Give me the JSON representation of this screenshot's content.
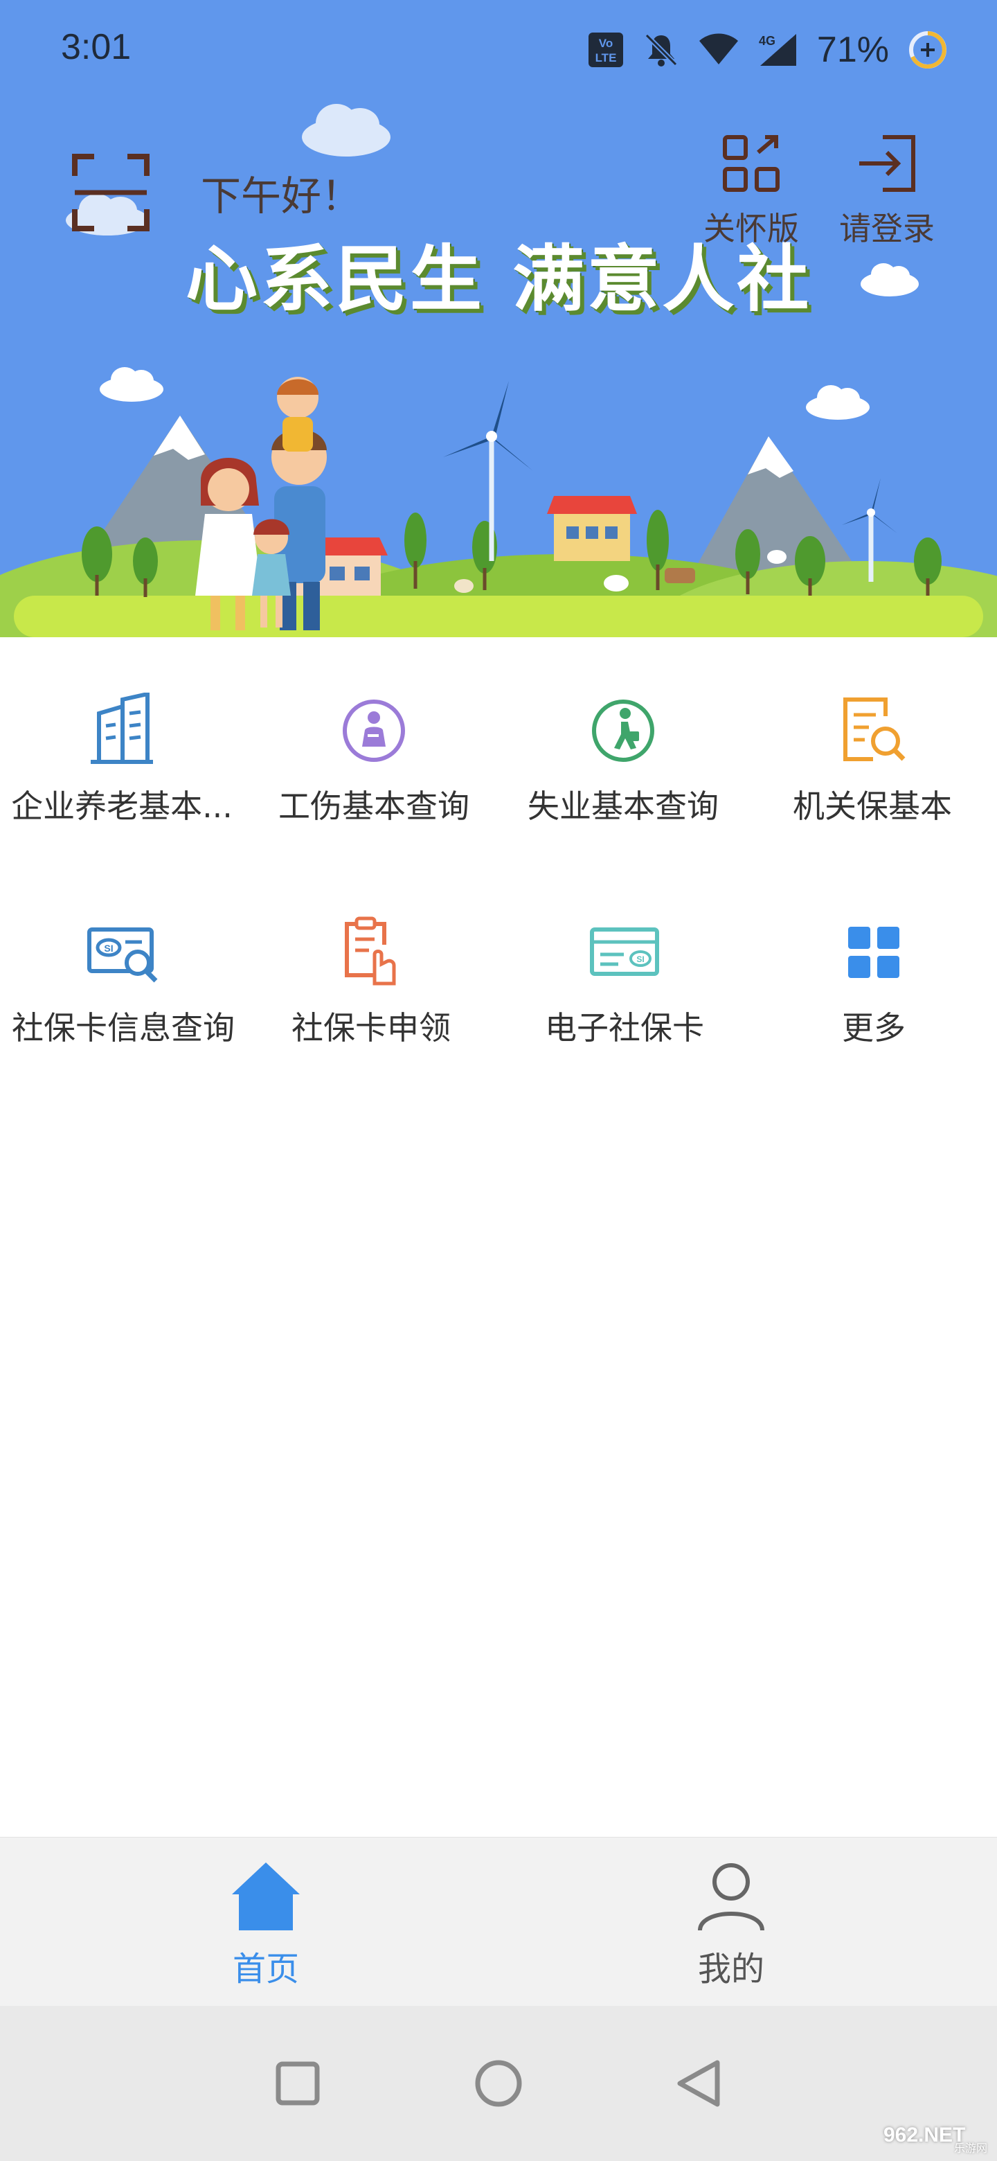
{
  "status_bar": {
    "time": "3:01",
    "battery": "71%",
    "icons": [
      "volte-icon",
      "mute-icon",
      "wifi-icon",
      "signal-4g-icon",
      "battery-saver-icon"
    ]
  },
  "header": {
    "greeting": "下午好！",
    "slogan": "心系民生 满意人社",
    "care_mode_label": "关怀版",
    "login_label": "请登录"
  },
  "services": [
    {
      "label": "企业养老基本...",
      "icon": "building-icon",
      "color": "#3D84C6"
    },
    {
      "label": "工伤基本查询",
      "icon": "injury-icon",
      "color": "#9B7BD8"
    },
    {
      "label": "失业基本查询",
      "icon": "walking-person-icon",
      "color": "#3FA56B"
    },
    {
      "label": "机关保基本",
      "icon": "document-search-icon",
      "color": "#F0A030"
    },
    {
      "label": "社保卡信息查询",
      "icon": "card-search-icon",
      "color": "#3D84C6"
    },
    {
      "label": "社保卡申领",
      "icon": "hand-apply-icon",
      "color": "#E8734A"
    },
    {
      "label": "电子社保卡",
      "icon": "e-card-icon",
      "color": "#5CC2BE"
    },
    {
      "label": "更多",
      "icon": "grid-more-icon",
      "color": "#3A8EEA"
    }
  ],
  "bottom_nav": {
    "home_label": "首页",
    "mine_label": "我的",
    "active_color": "#3A8EEA"
  },
  "watermark": {
    "text": "962.NET",
    "sub": "乐游网"
  }
}
